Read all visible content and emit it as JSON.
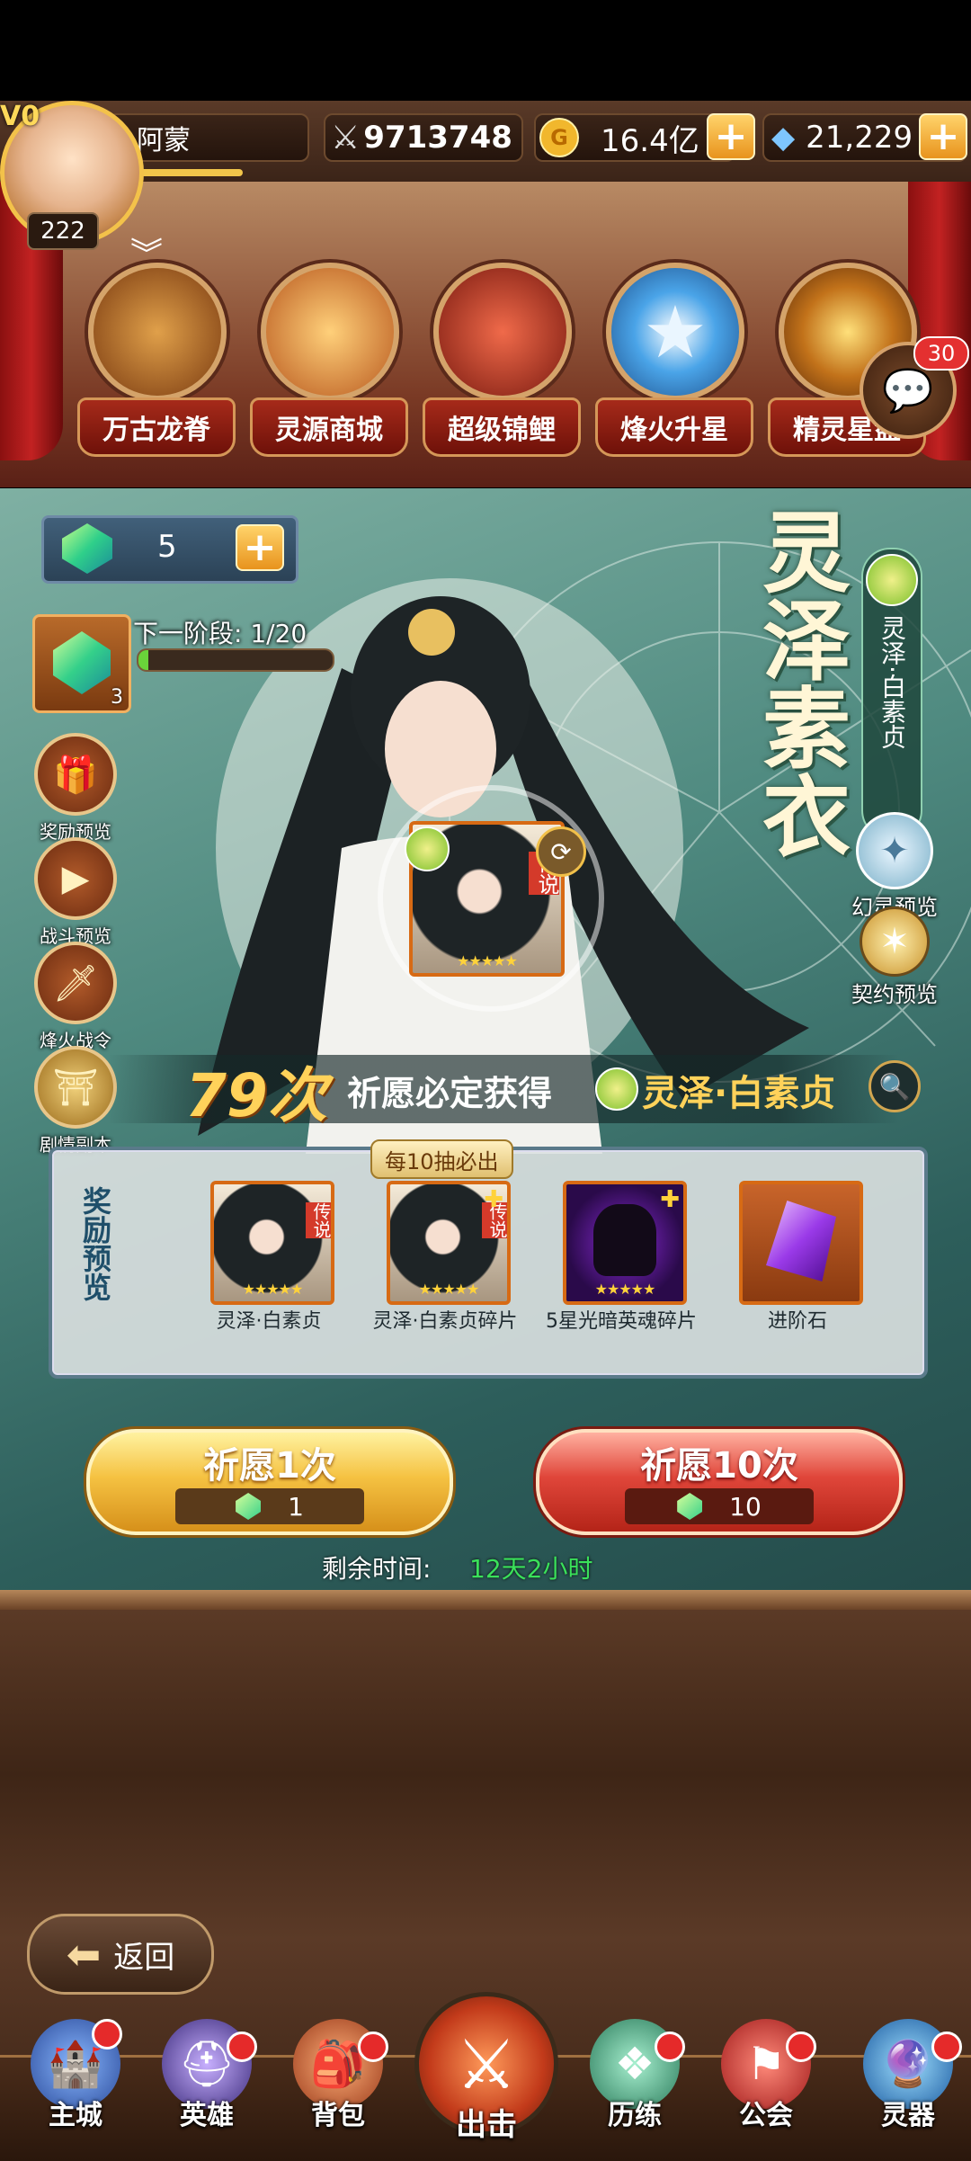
{
  "player": {
    "vip": "V0",
    "name": "阿蒙",
    "level": "222"
  },
  "resources": {
    "power": "9713748",
    "gold": "16.4亿",
    "diamonds": "21,229"
  },
  "features": [
    {
      "label": "万古龙脊"
    },
    {
      "label": "灵源商城"
    },
    {
      "label": "超级锦鲤"
    },
    {
      "label": "烽火升星"
    },
    {
      "label": "精灵星盘"
    }
  ],
  "chat": {
    "badge": "30"
  },
  "summon": {
    "ticket_count": "5",
    "stage_ticket_count": "3",
    "next_stage": "下一阶段: 1/20",
    "next_stage_progress": 0.05,
    "title": "灵泽素衣",
    "hero_tag": "灵泽·白素贞",
    "hero_rarity": "传说",
    "guarantee_count": "79次",
    "guarantee_text": "祈愿必定获得",
    "guarantee_hero": "灵泽·白素贞",
    "remaining_label": "剩余时间:",
    "remaining_value": "12天2小时"
  },
  "side_left": [
    {
      "label": "奖励预览"
    },
    {
      "label": "战斗预览"
    },
    {
      "label": "烽火战令"
    },
    {
      "label": "剧情副本"
    }
  ],
  "side_right": [
    {
      "label": "幻灵预览"
    },
    {
      "label": "契约预览"
    }
  ],
  "rewards": {
    "header": "奖励预览",
    "guarantee_badge": "每10抽必出",
    "items": [
      {
        "name": "灵泽·白素贞",
        "tag": "传说"
      },
      {
        "name": "灵泽·白素贞碎片",
        "tag": "传说"
      },
      {
        "name": "5星光暗英魂碎片",
        "tag": ""
      },
      {
        "name": "进阶石",
        "tag": ""
      }
    ]
  },
  "buttons": {
    "pull1_label": "祈愿1次",
    "pull1_cost": "1",
    "pull10_label": "祈愿10次",
    "pull10_cost": "10",
    "back_label": "返回"
  },
  "nav": [
    {
      "label": "主城"
    },
    {
      "label": "英雄"
    },
    {
      "label": "背包"
    },
    {
      "label": "出击"
    },
    {
      "label": "历练"
    },
    {
      "label": "公会"
    },
    {
      "label": "灵器"
    }
  ],
  "colors": {
    "accent_gold": "#f5c242",
    "accent_red": "#e0463a",
    "timer_green": "#3ae05a"
  }
}
